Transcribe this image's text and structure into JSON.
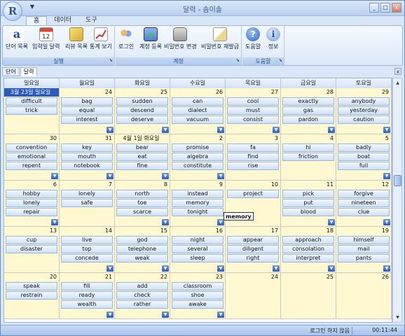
{
  "window": {
    "title": "달력 - 솜이솔",
    "logo": "R"
  },
  "menu_tabs": [
    "홈",
    "데이터",
    "도구"
  ],
  "ribbon": {
    "groups": [
      {
        "label": "실행",
        "buttons": [
          {
            "label": "단어 목록",
            "icon": "vocabulary-icon"
          },
          {
            "label": "입력일 달력",
            "icon": "calendar-icon"
          },
          {
            "label": "리뷰 목록",
            "icon": "review-icon"
          },
          {
            "label": "통계 보기",
            "icon": "chart-icon"
          }
        ]
      },
      {
        "label": "계정",
        "buttons": [
          {
            "label": "로그인",
            "icon": "users-icon"
          },
          {
            "label": "계정 등록",
            "icon": "register-icon"
          },
          {
            "label": "비밀번호 변경",
            "icon": "database-lock-icon"
          },
          {
            "label": "비밀번호 재발급",
            "icon": "mail-icon"
          }
        ]
      },
      {
        "label": "도움말",
        "buttons": [
          {
            "label": "도움말",
            "icon": "help-icon"
          },
          {
            "label": "정보",
            "icon": "info-icon"
          }
        ]
      }
    ]
  },
  "doc_tabs": [
    "단어",
    "달력"
  ],
  "weekdays": [
    "일요일",
    "월요일",
    "화요일",
    "수요일",
    "목요일",
    "금요일",
    "토요일"
  ],
  "weeks": [
    [
      {
        "date": "3월 23일 일요일",
        "selected": true,
        "events": [
          "difficult",
          "trick"
        ],
        "more": false
      },
      {
        "date": "24",
        "events": [
          "bag",
          "equal",
          "interest"
        ],
        "more": true
      },
      {
        "date": "25",
        "events": [
          "sudden",
          "descend",
          "deserve"
        ],
        "more": true
      },
      {
        "date": "26",
        "events": [
          "can",
          "dialect",
          "vacuum"
        ],
        "more": true
      },
      {
        "date": "27",
        "events": [
          "cool",
          "must",
          "consist"
        ],
        "more": true
      },
      {
        "date": "28",
        "events": [
          "exactly",
          "gas",
          "pardon"
        ],
        "more": true
      },
      {
        "date": "29",
        "events": [
          "anybody",
          "yesterday",
          "caution"
        ],
        "more": true
      }
    ],
    [
      {
        "date": "30",
        "events": [
          "convention",
          "emotional",
          "repent"
        ],
        "more": true
      },
      {
        "date": "31",
        "events": [
          "key",
          "mouth",
          "notebook"
        ],
        "more": true
      },
      {
        "date": "4월 1일 화요일",
        "month_start": true,
        "events": [
          "bear",
          "eat",
          "fine"
        ],
        "more": true
      },
      {
        "date": "2",
        "events": [
          "promise",
          "algebra",
          "constitute"
        ],
        "more": true
      },
      {
        "date": "3",
        "events": [
          "fa",
          "find",
          "rise"
        ],
        "more": false
      },
      {
        "date": "4",
        "events": [
          "hi",
          "friction"
        ],
        "more": false
      },
      {
        "date": "5",
        "events": [
          "badly",
          "boat",
          "full"
        ],
        "more": true
      }
    ],
    [
      {
        "date": "6",
        "events": [
          "hobby",
          "lonely",
          "repair"
        ],
        "more": true
      },
      {
        "date": "7",
        "events": [
          "lonely",
          "safe"
        ],
        "more": false
      },
      {
        "date": "8",
        "events": [
          "north",
          "toe",
          "scarce"
        ],
        "more": true
      },
      {
        "date": "9",
        "events": [
          "instead",
          "memory",
          "tonight"
        ],
        "more": true
      },
      {
        "date": "10",
        "events": [
          "project"
        ],
        "more": false
      },
      {
        "date": "11",
        "events": [
          "pick",
          "put",
          "blood"
        ],
        "more": true
      },
      {
        "date": "12",
        "events": [
          "forgive",
          "nineteen",
          "clue"
        ],
        "more": true
      }
    ],
    [
      {
        "date": "13",
        "events": [
          "cup",
          "disaster"
        ],
        "more": false
      },
      {
        "date": "14",
        "events": [
          "live",
          "top",
          "concede"
        ],
        "more": true
      },
      {
        "date": "15",
        "events": [
          "god",
          "telephone",
          "weak"
        ],
        "more": true
      },
      {
        "date": "16",
        "events": [
          "night",
          "several",
          "sleep"
        ],
        "more": true
      },
      {
        "date": "17",
        "events": [
          "appear",
          "diligent",
          "right"
        ],
        "more": true
      },
      {
        "date": "18",
        "events": [
          "approach",
          "consolation",
          "interpret"
        ],
        "more": true
      },
      {
        "date": "19",
        "events": [
          "himself",
          "mail",
          "pants"
        ],
        "more": true
      }
    ],
    [
      {
        "date": "20",
        "events": [
          "speak",
          "restrain"
        ],
        "more": false
      },
      {
        "date": "21",
        "events": [
          "fill",
          "ready",
          "wealth"
        ],
        "more": true
      },
      {
        "date": "22",
        "events": [
          "add",
          "check",
          "rather"
        ],
        "more": true
      },
      {
        "date": "23",
        "events": [
          "classroom",
          "shoe",
          "awake"
        ],
        "more": true
      },
      {
        "date": "24",
        "events": [],
        "more": false
      },
      {
        "date": "25",
        "events": [],
        "more": false
      },
      {
        "date": "26",
        "events": [],
        "more": false
      }
    ]
  ],
  "tooltip": "memory",
  "status": {
    "login": "로그인 하지 않음",
    "time": "00:11:44"
  }
}
